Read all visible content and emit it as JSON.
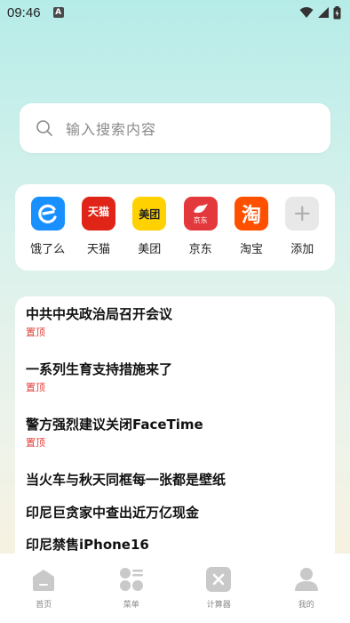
{
  "status_bar": {
    "time": "09:46",
    "notification_icon": "A"
  },
  "search": {
    "placeholder": "输入搜索内容"
  },
  "shortcuts": [
    {
      "label": "饿了么",
      "icon": "eleme-icon",
      "color": "#1890ff"
    },
    {
      "label": "天猫",
      "icon": "tmall-icon",
      "icon_text": "天猫",
      "color": "#e02418"
    },
    {
      "label": "美团",
      "icon": "meituan-icon",
      "icon_text": "美团",
      "color": "#ffd100"
    },
    {
      "label": "京东",
      "icon": "jd-icon",
      "icon_text": "京东",
      "color": "#e4393c"
    },
    {
      "label": "淘宝",
      "icon": "taobao-icon",
      "icon_text": "淘",
      "color": "#ff5000"
    },
    {
      "label": "添加",
      "icon": "add-icon",
      "icon_text": "+",
      "color": "#e8e8e8"
    }
  ],
  "news": [
    {
      "title": "中共中央政治局召开会议",
      "badge": "置顶"
    },
    {
      "title": "一系列生育支持措施来了",
      "badge": "置顶"
    },
    {
      "title": "警方强烈建议关闭FaceTime",
      "badge": "置顶"
    },
    {
      "title": "当火车与秋天同框每一张都是壁纸",
      "badge": ""
    },
    {
      "title": "印尼巨贪家中查出近万亿现金",
      "badge": ""
    },
    {
      "title": "印尼禁售iPhone16",
      "badge": ""
    }
  ],
  "tabs": [
    {
      "label": "首页",
      "icon": "home-icon"
    },
    {
      "label": "菜单",
      "icon": "menu-icon"
    },
    {
      "label": "计算器",
      "icon": "calculator-icon"
    },
    {
      "label": "我的",
      "icon": "profile-icon"
    }
  ]
}
